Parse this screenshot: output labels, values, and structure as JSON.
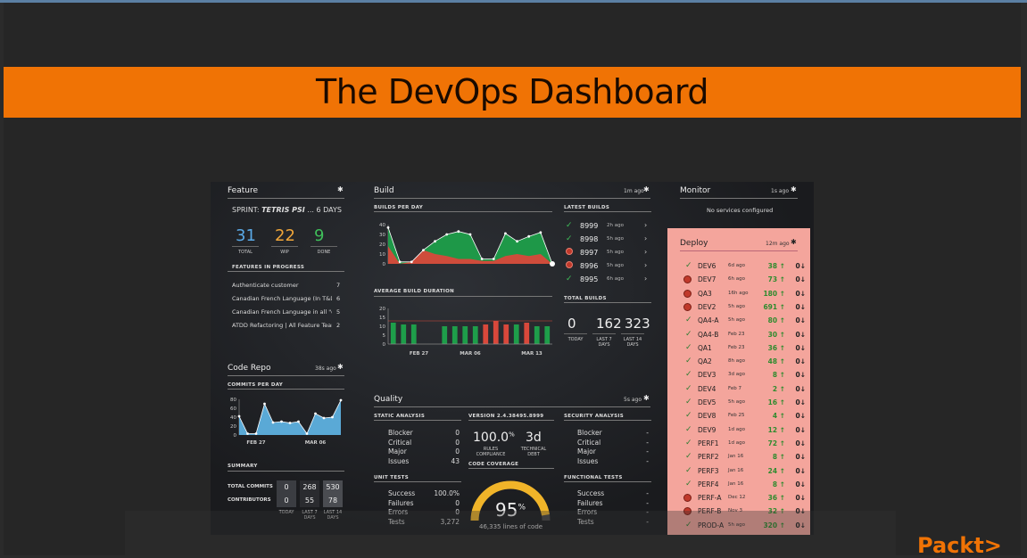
{
  "slide": {
    "title": "The DevOps Dashboard",
    "brand": "Packt>"
  },
  "feature": {
    "title": "Feature",
    "sprint_prefix": "SPRINT:",
    "sprint_name": "TETRIS PSI",
    "sprint_suffix": "... 6 DAYS",
    "stats": [
      {
        "value": "31",
        "label": "TOTAL",
        "color": "#5aa9e6"
      },
      {
        "value": "22",
        "label": "WIP",
        "color": "#f0a63a"
      },
      {
        "value": "9",
        "label": "DONE",
        "color": "#3fbf5a"
      }
    ],
    "in_progress_title": "FEATURES IN PROGRESS",
    "items": [
      {
        "name": "Authenticate customer",
        "count": "7"
      },
      {
        "name": "Canadian French Language (In T&D ...",
        "count": "6"
      },
      {
        "name": "Canadian French Language in all \"ot...",
        "count": "5"
      },
      {
        "name": "ATDD Refactoring | All Feature Teams",
        "count": "2"
      }
    ]
  },
  "code_repo": {
    "title": "Code Repo",
    "ago": "38s ago",
    "chart_title": "COMMITS PER DAY",
    "summary_title": "SUMMARY",
    "rows": [
      {
        "label": "TOTAL COMMITS",
        "values": [
          "0",
          "268",
          "530"
        ]
      },
      {
        "label": "CONTRIBUTORS",
        "values": [
          "0",
          "55",
          "78"
        ]
      }
    ],
    "cols": [
      "TODAY",
      "LAST 7 DAYS",
      "LAST 14 DAYS"
    ]
  },
  "build": {
    "title": "Build",
    "ago": "1m ago",
    "per_day_title": "BUILDS PER DAY",
    "avg_title": "AVERAGE BUILD DURATION",
    "latest_title": "LATEST BUILDS",
    "latest": [
      {
        "num": "8999",
        "when": "2h ago",
        "status": "ok"
      },
      {
        "num": "8998",
        "when": "5h ago",
        "status": "ok"
      },
      {
        "num": "8997",
        "when": "5h ago",
        "status": "fail"
      },
      {
        "num": "8996",
        "when": "5h ago",
        "status": "fail"
      },
      {
        "num": "8995",
        "when": "6h ago",
        "status": "ok"
      }
    ],
    "total_title": "TOTAL BUILDS",
    "totals": [
      {
        "value": "0",
        "label": "TODAY"
      },
      {
        "value": "162",
        "label": "LAST 7 DAYS"
      },
      {
        "value": "323",
        "label": "LAST 14 DAYS"
      }
    ]
  },
  "quality": {
    "title": "Quality",
    "ago": "5s ago",
    "static_title": "STATIC ANALYSIS",
    "static": [
      {
        "label": "Blocker",
        "value": "0"
      },
      {
        "label": "Critical",
        "value": "0"
      },
      {
        "label": "Major",
        "value": "0"
      },
      {
        "label": "Issues",
        "value": "43"
      }
    ],
    "version": "VERSION 2.4.38495.8999",
    "rules_value": "100.0",
    "rules_unit": "%",
    "rules_label": "RULES COMPLIANCE",
    "debt_value": "3d",
    "debt_label": "TECHNICAL DEBT",
    "coverage_title": "CODE COVERAGE",
    "coverage_value": "95",
    "coverage_unit": "%",
    "coverage_percent": 95,
    "coverage_lines": "46,335 lines of code",
    "unit_title": "UNIT TESTS",
    "unit": [
      {
        "label": "Success",
        "value": "100.0%"
      },
      {
        "label": "Failures",
        "value": "0"
      },
      {
        "label": "Errors",
        "value": "0"
      },
      {
        "label": "Tests",
        "value": "3,272"
      }
    ],
    "security_title": "SECURITY ANALYSIS",
    "security": [
      {
        "label": "Blocker",
        "value": "-"
      },
      {
        "label": "Critical",
        "value": "-"
      },
      {
        "label": "Major",
        "value": "-"
      },
      {
        "label": "Issues",
        "value": "-"
      }
    ],
    "functional_title": "FUNCTIONAL TESTS",
    "functional": [
      {
        "label": "Success",
        "value": "-"
      },
      {
        "label": "Failures",
        "value": "-"
      },
      {
        "label": "Errors",
        "value": "-"
      },
      {
        "label": "Tests",
        "value": "-"
      }
    ]
  },
  "monitor": {
    "title": "Monitor",
    "ago": "1s ago",
    "message": "No services configured"
  },
  "deploy": {
    "title": "Deploy",
    "ago": "12m ago",
    "rows": [
      {
        "name": "DEV6",
        "when": "6d ago",
        "up": "38",
        "down": "0",
        "status": "ok"
      },
      {
        "name": "DEV7",
        "when": "6h ago",
        "up": "73",
        "down": "0",
        "status": "fail"
      },
      {
        "name": "QA3",
        "when": "16h ago",
        "up": "180",
        "down": "0",
        "status": "fail"
      },
      {
        "name": "DEV2",
        "when": "5h ago",
        "up": "691",
        "down": "0",
        "status": "fail"
      },
      {
        "name": "QA4-A",
        "when": "5h ago",
        "up": "80",
        "down": "0",
        "status": "ok"
      },
      {
        "name": "QA4-B",
        "when": "Feb 23",
        "up": "30",
        "down": "0",
        "status": "ok"
      },
      {
        "name": "QA1",
        "when": "Feb 23",
        "up": "36",
        "down": "0",
        "status": "ok"
      },
      {
        "name": "QA2",
        "when": "8h ago",
        "up": "48",
        "down": "0",
        "status": "ok"
      },
      {
        "name": "DEV3",
        "when": "3d ago",
        "up": "8",
        "down": "0",
        "status": "ok"
      },
      {
        "name": "DEV4",
        "when": "Feb 7",
        "up": "2",
        "down": "0",
        "status": "ok"
      },
      {
        "name": "DEV5",
        "when": "5h ago",
        "up": "16",
        "down": "0",
        "status": "ok"
      },
      {
        "name": "DEV8",
        "when": "Feb 25",
        "up": "4",
        "down": "0",
        "status": "ok"
      },
      {
        "name": "DEV9",
        "when": "1d ago",
        "up": "12",
        "down": "0",
        "status": "ok"
      },
      {
        "name": "PERF1",
        "when": "1d ago",
        "up": "72",
        "down": "0",
        "status": "ok"
      },
      {
        "name": "PERF2",
        "when": "Jan 16",
        "up": "8",
        "down": "0",
        "status": "ok"
      },
      {
        "name": "PERF3",
        "when": "Jan 16",
        "up": "24",
        "down": "0",
        "status": "ok"
      },
      {
        "name": "PERF4",
        "when": "Jan 16",
        "up": "8",
        "down": "0",
        "status": "ok"
      },
      {
        "name": "PERF-A",
        "when": "Dec 12",
        "up": "36",
        "down": "0",
        "status": "fail"
      },
      {
        "name": "PERF-B",
        "when": "Nov 3",
        "up": "32",
        "down": "0",
        "status": "fail"
      },
      {
        "name": "PROD-A",
        "when": "5h ago",
        "up": "320",
        "down": "0",
        "status": "ok"
      }
    ]
  },
  "chart_data": [
    {
      "type": "area",
      "title": "BUILDS PER DAY",
      "ylim": [
        0,
        40
      ],
      "yticks": [
        "40",
        "30",
        "20",
        "10",
        "0"
      ],
      "series": [
        {
          "color": "#1e9e4a",
          "values": [
            37,
            2,
            2,
            14,
            23,
            30,
            33,
            30,
            5,
            5,
            31,
            23,
            28,
            32,
            0
          ]
        },
        {
          "color": "#d9483b",
          "values": [
            18,
            0,
            2,
            14,
            10,
            8,
            5,
            5,
            3,
            3,
            8,
            10,
            8,
            10,
            0
          ]
        }
      ]
    },
    {
      "type": "bar",
      "title": "AVERAGE BUILD DURATION",
      "ylim": [
        0,
        20
      ],
      "yticks": [
        "20",
        "15",
        "10",
        "5",
        "0"
      ],
      "xticks": [
        "FEB 27",
        "MAR 06",
        "MAR 13"
      ],
      "values": [
        12,
        11,
        11,
        0,
        0,
        10,
        10,
        10,
        10,
        11,
        13,
        11,
        11,
        12,
        10,
        10
      ],
      "status": [
        "ok",
        "ok",
        "ok",
        "ok",
        "ok",
        "ok",
        "ok",
        "ok",
        "ok",
        "fail",
        "fail",
        "fail",
        "ok",
        "fail",
        "ok",
        "ok"
      ]
    },
    {
      "type": "area",
      "title": "COMMITS PER DAY",
      "ylim": [
        0,
        80
      ],
      "yticks": [
        "80",
        "60",
        "40",
        "20",
        "0"
      ],
      "xticks": [
        "FEB 27",
        "MAR 06"
      ],
      "values": [
        42,
        3,
        3,
        70,
        28,
        30,
        27,
        30,
        3,
        48,
        38,
        40,
        78
      ]
    }
  ]
}
